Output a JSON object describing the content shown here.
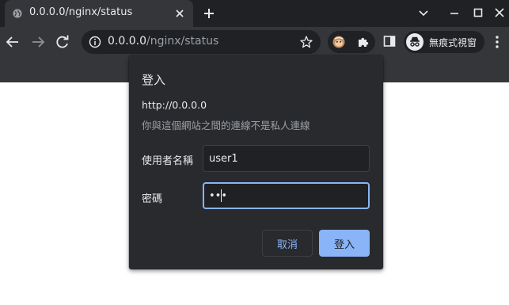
{
  "tab": {
    "title": "0.0.0.0/nginx/status",
    "favicon": "globe-icon",
    "close_icon": "close-icon"
  },
  "tabstrip": {
    "new_tab_icon": "plus-icon",
    "window_controls": [
      "chevron-down-icon",
      "minimize-icon",
      "maximize-icon",
      "close-icon"
    ]
  },
  "toolbar": {
    "url_host": "0.0.0.0",
    "url_path": "/nginx/status",
    "incognito_label": "無痕式視窗"
  },
  "dialog": {
    "title": "登入",
    "origin": "http://0.0.0.0",
    "warning": "你與這個網站之間的連線不是私人連線",
    "username_label": "使用者名稱",
    "username_value": "user1",
    "password_label": "密碼",
    "password_value": "•••",
    "cancel_label": "取消",
    "submit_label": "登入"
  },
  "colors": {
    "accent": "#8ab4f8",
    "dialog_bg": "#292a2d",
    "chrome_dark": "#202124",
    "toolbar": "#35363a"
  }
}
